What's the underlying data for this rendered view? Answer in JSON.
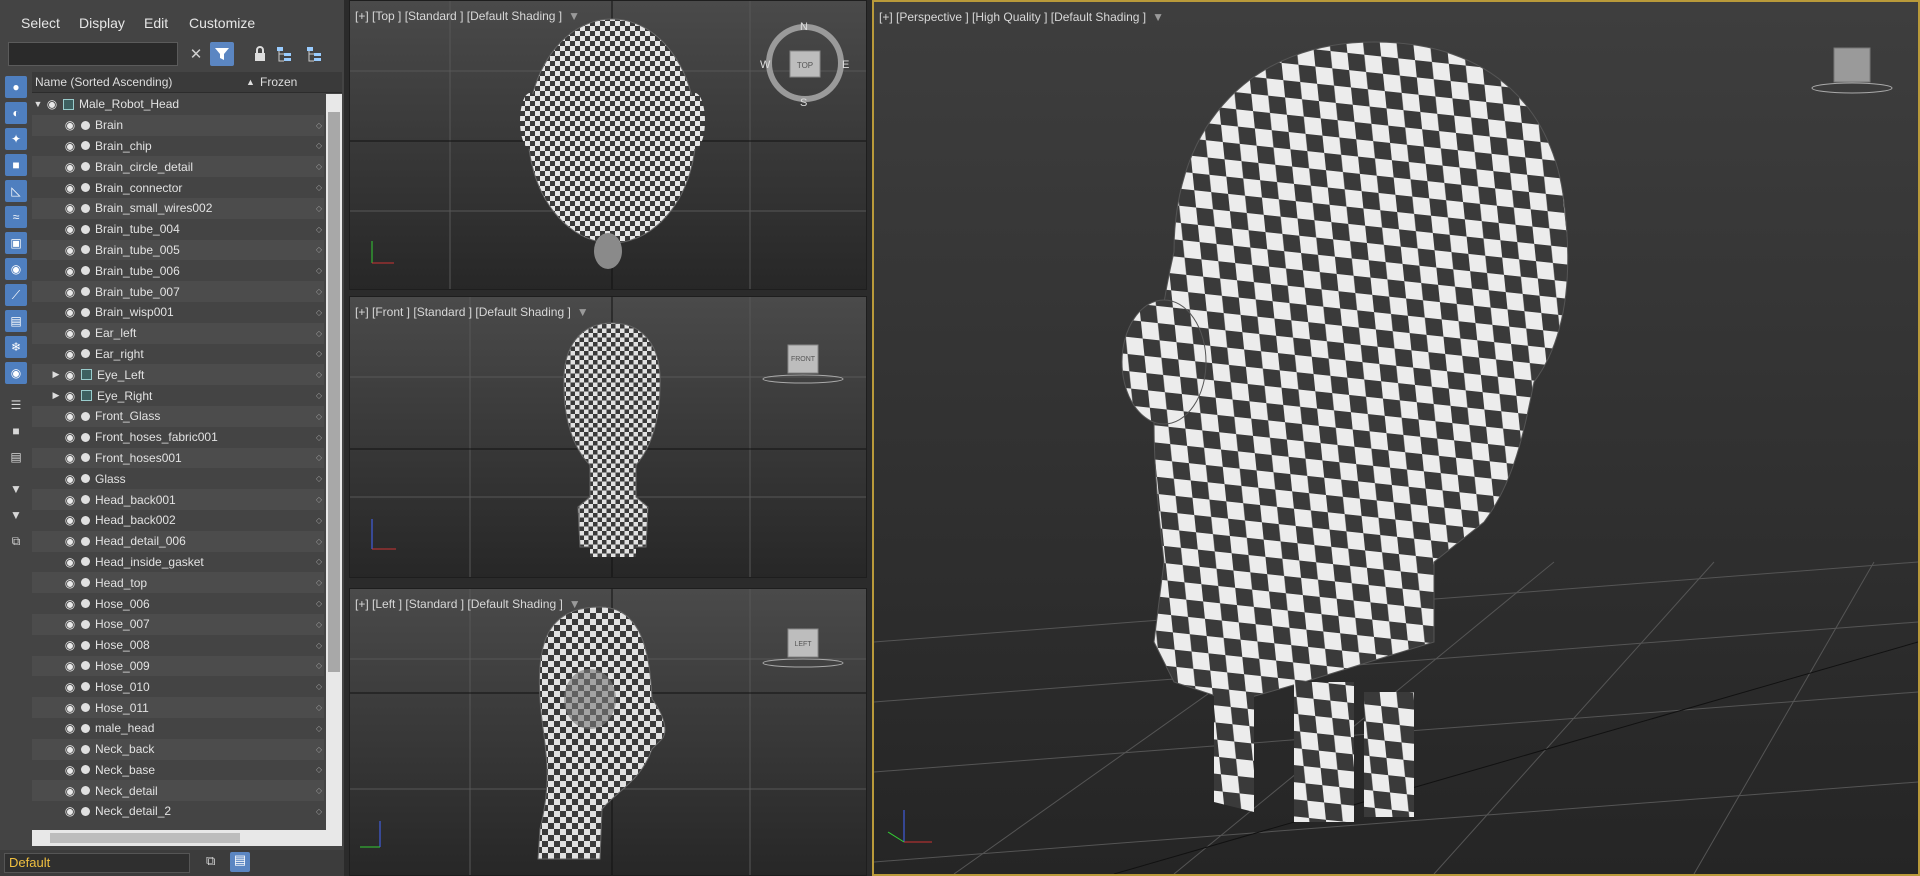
{
  "menu": [
    "Select",
    "Display",
    "Edit",
    "Customize"
  ],
  "search": {
    "value": ""
  },
  "tree_header": {
    "name_col": "Name (Sorted Ascending)",
    "sort_arrow": "▲",
    "frozen_col": "Frozen"
  },
  "tree": {
    "root": "Male_Robot_Head",
    "items": [
      {
        "label": "Brain",
        "has_children": false
      },
      {
        "label": "Brain_chip",
        "has_children": false
      },
      {
        "label": "Brain_circle_detail",
        "has_children": false
      },
      {
        "label": "Brain_connector",
        "has_children": false
      },
      {
        "label": "Brain_small_wires002",
        "has_children": false
      },
      {
        "label": "Brain_tube_004",
        "has_children": false
      },
      {
        "label": "Brain_tube_005",
        "has_children": false
      },
      {
        "label": "Brain_tube_006",
        "has_children": false
      },
      {
        "label": "Brain_tube_007",
        "has_children": false
      },
      {
        "label": "Brain_wisp001",
        "has_children": false
      },
      {
        "label": "Ear_left",
        "has_children": false
      },
      {
        "label": "Ear_right",
        "has_children": false
      },
      {
        "label": "Eye_Left",
        "has_children": true
      },
      {
        "label": "Eye_Right",
        "has_children": true
      },
      {
        "label": "Front_Glass",
        "has_children": false
      },
      {
        "label": "Front_hoses_fabric001",
        "has_children": false
      },
      {
        "label": "Front_hoses001",
        "has_children": false
      },
      {
        "label": "Glass",
        "has_children": false
      },
      {
        "label": "Head_back001",
        "has_children": false
      },
      {
        "label": "Head_back002",
        "has_children": false
      },
      {
        "label": "Head_detail_006",
        "has_children": false
      },
      {
        "label": "Head_inside_gasket",
        "has_children": false
      },
      {
        "label": "Head_top",
        "has_children": false
      },
      {
        "label": "Hose_006",
        "has_children": false
      },
      {
        "label": "Hose_007",
        "has_children": false
      },
      {
        "label": "Hose_008",
        "has_children": false
      },
      {
        "label": "Hose_009",
        "has_children": false
      },
      {
        "label": "Hose_010",
        "has_children": false
      },
      {
        "label": "Hose_011",
        "has_children": false
      },
      {
        "label": "male_head",
        "has_children": false
      },
      {
        "label": "Neck_back",
        "has_children": false
      },
      {
        "label": "Neck_base",
        "has_children": false
      },
      {
        "label": "Neck_detail",
        "has_children": false
      },
      {
        "label": "Neck_detail_2",
        "has_children": false
      }
    ]
  },
  "layer": {
    "value": "Default"
  },
  "viewports": {
    "top": {
      "label": "[+] [Top ] [Standard ] [Default Shading ]",
      "cube": "TOP",
      "compass": [
        "N",
        "S",
        "W",
        "E"
      ]
    },
    "front": {
      "label": "[+] [Front ] [Standard ] [Default Shading ]",
      "cube": "FRONT"
    },
    "left": {
      "label": "[+] [Left ] [Standard ] [Default Shading ]",
      "cube": "LEFT"
    },
    "persp": {
      "label": "[+] [Perspective ] [High Quality ] [Default Shading ]"
    }
  },
  "colors": {
    "active_viewport_border": "#b99a3a",
    "toolbar_active": "#5b86c2",
    "layer_text": "#f0c040"
  },
  "icons": [
    "close-icon",
    "filter-icon",
    "lock-icon",
    "hierarchy-icon",
    "eye-icon",
    "funnel-icon",
    "layers-icon"
  ]
}
